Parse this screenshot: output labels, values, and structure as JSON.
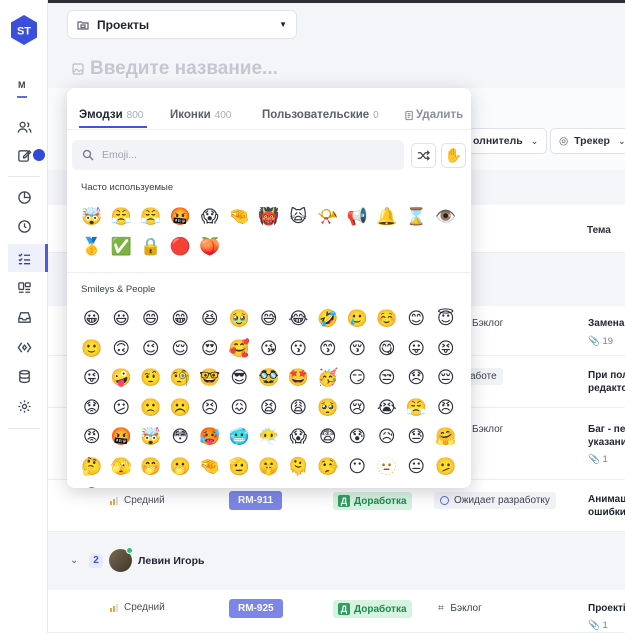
{
  "app": {
    "logo_text": "ST"
  },
  "sidebar": {
    "section_letter": "М",
    "icons": [
      "users-icon",
      "edit-icon",
      "chart-pie-icon",
      "clock-icon",
      "checklist-icon",
      "board-icon",
      "inbox-icon",
      "link-icon",
      "database-icon",
      "gear-icon"
    ]
  },
  "header": {
    "project_select_label": "Проекты",
    "title_placeholder": "Введите название..."
  },
  "filters": {
    "assignee": "олнитель",
    "tracker": "Трекер"
  },
  "table": {
    "topic_header": "Тема",
    "rows": [
      {
        "status": "Бэклог",
        "topic": "Замена",
        "meta": "19"
      },
      {
        "status": "аботе",
        "topic_line1": "При пол",
        "topic_line2": "редакто"
      },
      {
        "status": "Бэклог",
        "topic_line1": "Баг - пер",
        "topic_line2": "указани",
        "meta": "1"
      },
      {
        "priority": "Средний",
        "id": "RM-911",
        "stage": "Доработка",
        "stage_letter": "Д",
        "status": "Ожидает разработку",
        "topic_line1": "Анимац",
        "topic_line2": "ошибки"
      },
      {
        "priority": "Средний",
        "id": "RM-925",
        "stage": "Доработка",
        "stage_letter": "Д",
        "status": "Бэклог",
        "topic": "Проекті",
        "meta": "1"
      }
    ],
    "group": {
      "count": "2",
      "name": "Левин Игорь"
    }
  },
  "picker": {
    "tabs": [
      {
        "label": "Эмодзи",
        "count": "800"
      },
      {
        "label": "Иконки",
        "count": "400"
      },
      {
        "label": "Пользовательские",
        "count": "0"
      }
    ],
    "delete_label": "Удалить",
    "search_placeholder": "Emoji...",
    "shuffle_icon": "shuffle-icon",
    "hand_emoji": "✋",
    "frequent_label": "Часто используемые",
    "frequent": [
      "🤯",
      "😤",
      "😤",
      "🤬",
      "😱",
      "🤏",
      "👹",
      "🙀",
      "📯",
      "📢",
      "🔔",
      "⌛",
      "👁️",
      "🥇",
      "✅",
      "🔒",
      "🔴",
      "🍑"
    ],
    "smileys_label": "Smileys & People",
    "smileys": [
      "😀",
      "😃",
      "😄",
      "😁",
      "😆",
      "🥹",
      "😅",
      "😂",
      "🤣",
      "🥲",
      "☺️",
      "😊",
      "😇",
      "🙂",
      "🙃",
      "😉",
      "😌",
      "😍",
      "🥰",
      "😘",
      "😗",
      "😙",
      "😚",
      "😋",
      "😛",
      "😝",
      "😜",
      "🤪",
      "🤨",
      "🧐",
      "🤓",
      "😎",
      "🥸",
      "🤩",
      "🥳",
      "😏",
      "😒",
      "😞",
      "😔",
      "😟",
      "😕",
      "🙁",
      "☹️",
      "😣",
      "😖",
      "😫",
      "😩",
      "🥺",
      "😢",
      "😭",
      "😤",
      "😠",
      "😡",
      "🤬",
      "🤯",
      "😳",
      "🥵",
      "🥶",
      "😶‍🌫️",
      "😱",
      "😨",
      "😰",
      "😥",
      "😓",
      "🤗",
      "🤔",
      "🫣",
      "🤭",
      "🫢",
      "🤏",
      "🫡",
      "🤫",
      "🫠",
      "🤥",
      "😶",
      "🫥",
      "😐",
      "🫤",
      "😑"
    ]
  }
}
